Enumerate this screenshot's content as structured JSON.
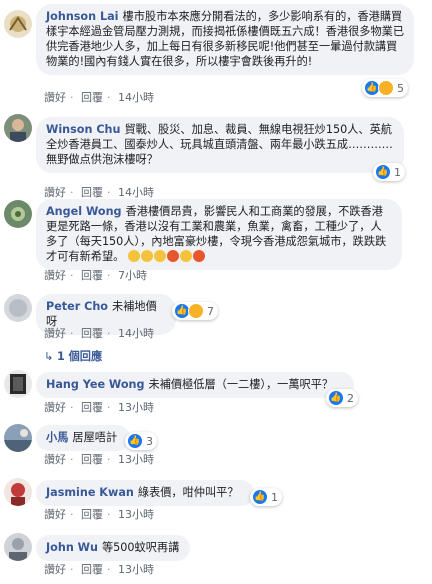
{
  "comments": [
    {
      "author": "Johnson Lai",
      "text": "樓市股市本來應分開看法的，多少影响系有的，香港購買樣宇本經過金管局壓力測規，而接揭祇係樓價既五六成！香港很多物業已供完香港地少人多，加上每日有很多新移民呢!他們甚至一暈過付款講買物業的!國內有錢人實在很多，所以樓宇會跌後再升的!",
      "like": "讚好",
      "reply": "回覆",
      "time": "14小時",
      "reaction_count": "5"
    },
    {
      "author": "Winson Chu",
      "text": "貿戰、股災、加息、裁員、無線电視狂炒150人、英航全炒香港員工、國泰炒人、玩具城直頭清盤、兩年最小跌五成…………無野做点供泡沫樓呀？",
      "like": "讚好",
      "reply": "回覆",
      "time": "14小時",
      "reaction_count": "1"
    },
    {
      "author": "Angel Wong",
      "text": "香港樓價昂貴，影響民人和工商業的發展，不跌香港更是死路一條，香港以沒有工業和農業，魚業，禽畜，工種少了，人多了（每天150人），內地富豪炒樓，令現今香港成怨氣城市，跌跌跌才可有新希望。",
      "like": "讚好",
      "reply": "回覆",
      "time": "7小時"
    },
    {
      "author": "Peter Cho",
      "text": "未補地價呀",
      "like": "讚好",
      "reply": "回覆",
      "time": "14小時",
      "reaction_count": "7",
      "replies_label": "1 個回應"
    },
    {
      "author": "Hang Yee Wong",
      "text": "未補價極低層（一二樓），一萬呎平？",
      "like": "讚好",
      "reply": "回覆",
      "time": "13小時",
      "reaction_count": "2"
    },
    {
      "author": "小馬",
      "text": "居屋唔計",
      "like": "讚好",
      "reply": "回覆",
      "time": "13小時",
      "reaction_count": "3"
    },
    {
      "author": "Jasmine Kwan",
      "text": "綠表價，咁仲叫平？",
      "like": "讚好",
      "reply": "回覆",
      "time": "13小時",
      "reaction_count": "1"
    },
    {
      "author": "John Wu",
      "text": "等500蚊呎再講",
      "like": "讚好",
      "reply": "回覆",
      "time": "13小時"
    }
  ],
  "colors": {
    "link": "#385898",
    "bubble": "#f0f2f5",
    "meta": "#606770",
    "like": "#1877f2"
  }
}
